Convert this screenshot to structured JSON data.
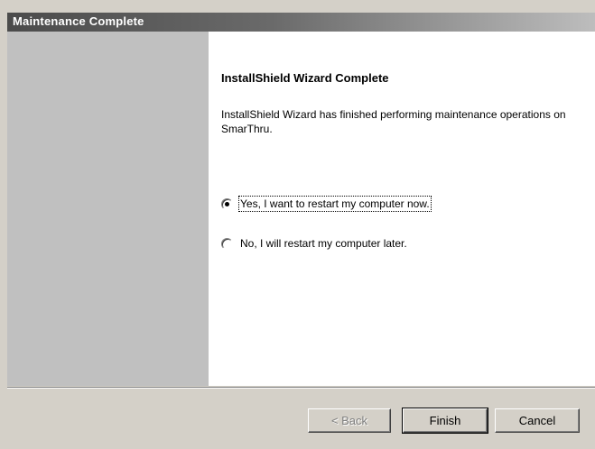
{
  "window": {
    "title": "Maintenance Complete"
  },
  "content": {
    "heading": "InstallShield Wizard Complete",
    "body": "InstallShield Wizard has finished performing maintenance operations on SmarThru.",
    "options": [
      {
        "label": "Yes, I want to restart my computer now.",
        "selected": true
      },
      {
        "label": "No, I will restart my computer later.",
        "selected": false
      }
    ]
  },
  "buttons": {
    "back": "< Back",
    "finish": "Finish",
    "cancel": "Cancel"
  },
  "colors": {
    "titlebar_dark": "#4b4b4b",
    "panel": "#c0c0c0",
    "dialog_bg": "#d4d0c8"
  }
}
